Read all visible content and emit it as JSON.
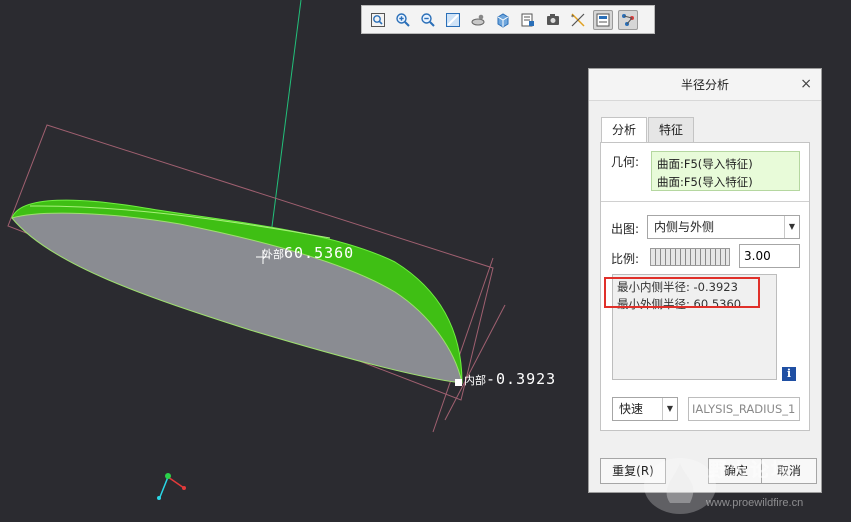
{
  "toolbar": {
    "buttons": [
      {
        "icon": "zoom-fit-icon"
      },
      {
        "icon": "zoom-in-icon"
      },
      {
        "icon": "zoom-out-icon"
      },
      {
        "icon": "repaint-icon"
      },
      {
        "icon": "spin-center-icon"
      },
      {
        "icon": "shading-display-icon"
      },
      {
        "icon": "saved-views-icon"
      },
      {
        "icon": "view-manager-icon"
      },
      {
        "icon": "datum-display-icon"
      },
      {
        "icon": "annotation-display-icon",
        "active": true
      },
      {
        "icon": "graph-display-icon",
        "active": true
      }
    ]
  },
  "viewport": {
    "outer_label_prefix": "外部",
    "outer_label_value": "60.5360",
    "inner_label_prefix": "内部",
    "inner_label_value": "-0.3923",
    "surface_color": "#3fbf14",
    "inner_face_color": "#8a8c92",
    "bbox_color": "#a06070",
    "axis_color": "#22c07a"
  },
  "dialog": {
    "title": "半径分析",
    "close": "×",
    "tabs": [
      {
        "label": "分析",
        "active": true
      },
      {
        "label": "特征",
        "active": false
      }
    ],
    "geometry_label": "几何:",
    "geometry_items": [
      "曲面:F5(导入特征)",
      "曲面:F5(导入特征)"
    ],
    "plot_label": "出图:",
    "plot_value": "内侧与外侧",
    "scale_label": "比例:",
    "scale_value": "3.00",
    "results": [
      "最小内侧半径: -0.3923",
      "最小外侧半径: 60.5360"
    ],
    "info": "i",
    "mode_value": "快速",
    "name_value": "IALYSIS_RADIUS_1",
    "repeat_button": "重复(R)",
    "ok_button": "确定",
    "cancel_button": "取消"
  },
  "watermark": {
    "text": "野火论坛",
    "url": "www.proewildfire.cn"
  },
  "colors": {
    "highlight": "#e0302a",
    "geometry_bg": "#e8fbd9"
  }
}
